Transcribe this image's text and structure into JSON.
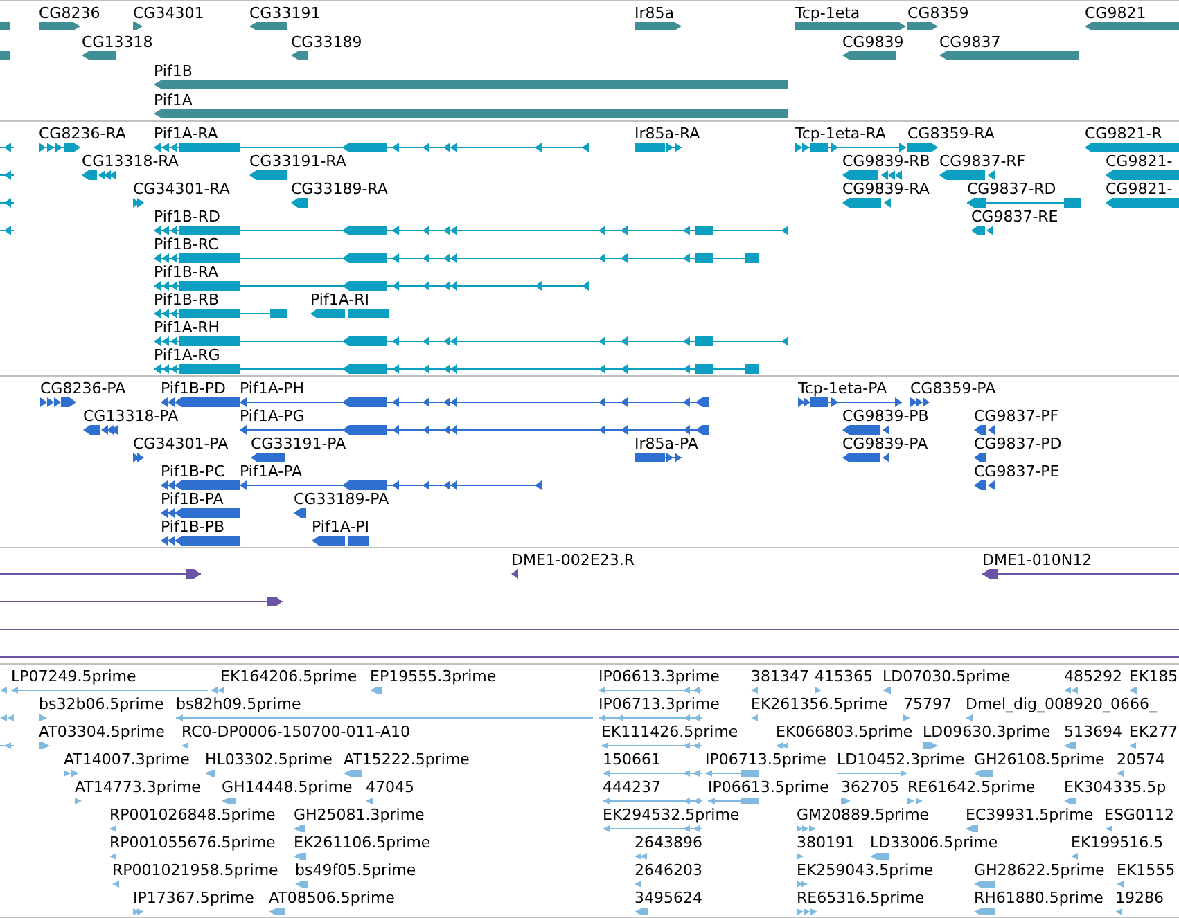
{
  "tracks": [
    {
      "kind": "gene",
      "features": [
        {
          "label": "CG8236"
        },
        {
          "label": "CG34301"
        },
        {
          "label": "CG33191"
        },
        {
          "label": "Ir85a"
        },
        {
          "label": "Tcp-1eta"
        },
        {
          "label": "CG8359"
        },
        {
          "label": "CG9821"
        },
        {
          "label": "CG13318"
        },
        {
          "label": "CG33189"
        },
        {
          "label": "CG9839"
        },
        {
          "label": "CG9837"
        },
        {
          "label": "Pif1B"
        },
        {
          "label": "Pif1A"
        }
      ]
    },
    {
      "kind": "mrna",
      "features": [
        {
          "label": "CG8236-RA"
        },
        {
          "label": "Pif1A-RA"
        },
        {
          "label": "Ir85a-RA"
        },
        {
          "label": "Tcp-1eta-RA"
        },
        {
          "label": "CG8359-RA"
        },
        {
          "label": "CG9821-R"
        },
        {
          "label": "CG13318-RA"
        },
        {
          "label": "CG33191-RA"
        },
        {
          "label": "CG9839-RB"
        },
        {
          "label": "CG9837-RF"
        },
        {
          "label": "CG9821-"
        },
        {
          "label": "CG34301-RA"
        },
        {
          "label": "CG33189-RA"
        },
        {
          "label": "CG9839-RA"
        },
        {
          "label": "CG9837-RD"
        },
        {
          "label": "CG9821-"
        },
        {
          "label": "Pif1B-RD"
        },
        {
          "label": "CG9837-RE"
        },
        {
          "label": "Pif1B-RC"
        },
        {
          "label": "Pif1B-RA"
        },
        {
          "label": "Pif1B-RB"
        },
        {
          "label": "Pif1A-RI"
        },
        {
          "label": "Pif1A-RH"
        },
        {
          "label": "Pif1A-RG"
        }
      ]
    },
    {
      "kind": "polypeptide",
      "features": [
        {
          "label": "CG8236-PA"
        },
        {
          "label": "Pif1B-PD"
        },
        {
          "label": "Pif1A-PH"
        },
        {
          "label": "Tcp-1eta-PA"
        },
        {
          "label": "CG8359-PA"
        },
        {
          "label": "CG13318-PA"
        },
        {
          "label": "Pif1A-PG"
        },
        {
          "label": "CG9839-PB"
        },
        {
          "label": "CG9837-PF"
        },
        {
          "label": "CG34301-PA"
        },
        {
          "label": "CG33191-PA"
        },
        {
          "label": "Ir85a-PA"
        },
        {
          "label": "CG9839-PA"
        },
        {
          "label": "CG9837-PD"
        },
        {
          "label": "Pif1B-PC"
        },
        {
          "label": "Pif1A-PA"
        },
        {
          "label": "CG9837-PE"
        },
        {
          "label": "Pif1B-PA"
        },
        {
          "label": "CG33189-PA"
        },
        {
          "label": "Pif1B-PB"
        },
        {
          "label": "Pif1A-PI"
        }
      ]
    },
    {
      "kind": "clone",
      "features": [
        {
          "label": "DME1-002E23.R"
        },
        {
          "label": "DME1-010N12"
        }
      ]
    },
    {
      "kind": "est",
      "features": [
        {
          "label": "LP07249.5prime"
        },
        {
          "label": "EK164206.5prime"
        },
        {
          "label": "EP19555.3prime"
        },
        {
          "label": "IP06613.3prime"
        },
        {
          "label": "381347"
        },
        {
          "label": "415365"
        },
        {
          "label": "LD07030.5prime"
        },
        {
          "label": "485292"
        },
        {
          "label": "EK185"
        },
        {
          "label": "bs32b06.5prime"
        },
        {
          "label": "bs82h09.5prime"
        },
        {
          "label": "IP06713.3prime"
        },
        {
          "label": "EK261356.5prime"
        },
        {
          "label": "75797"
        },
        {
          "label": "Dmel_dig_008920_0666_"
        },
        {
          "label": "AT03304.5prime"
        },
        {
          "label": "RC0-DP0006-150700-011-A10"
        },
        {
          "label": "EK111426.5prime"
        },
        {
          "label": "EK066803.5prime"
        },
        {
          "label": "LD09630.3prime"
        },
        {
          "label": "513694"
        },
        {
          "label": "EK277"
        },
        {
          "label": "AT14007.3prime"
        },
        {
          "label": "HL03302.5prime"
        },
        {
          "label": "AT15222.5prime"
        },
        {
          "label": "150661"
        },
        {
          "label": "IP06713.5prime"
        },
        {
          "label": "LD10452.3prime"
        },
        {
          "label": "GH26108.5prime"
        },
        {
          "label": "20574"
        },
        {
          "label": "AT14773.3prime"
        },
        {
          "label": "GH14448.5prime"
        },
        {
          "label": "47045"
        },
        {
          "label": "444237"
        },
        {
          "label": "IP06613.5prime"
        },
        {
          "label": "362705"
        },
        {
          "label": "RE61642.5prime"
        },
        {
          "label": "EK304335.5p"
        },
        {
          "label": "RP001026848.5prime"
        },
        {
          "label": "GH25081.3prime"
        },
        {
          "label": "EK294532.5prime"
        },
        {
          "label": "GM20889.5prime"
        },
        {
          "label": "EC39931.5prime"
        },
        {
          "label": "ESG0112"
        },
        {
          "label": "RP001055676.5prime"
        },
        {
          "label": "EK261106.5prime"
        },
        {
          "label": "2643896"
        },
        {
          "label": "380191"
        },
        {
          "label": "LD33006.5prime"
        },
        {
          "label": "EK199516.5"
        },
        {
          "label": "RP001021958.5prime"
        },
        {
          "label": "bs49f05.5prime"
        },
        {
          "label": "2646203"
        },
        {
          "label": "EK259043.5prime"
        },
        {
          "label": "GH28622.5prime"
        },
        {
          "label": "EK1555"
        },
        {
          "label": "IP17367.5prime"
        },
        {
          "label": "AT08506.5prime"
        },
        {
          "label": "3495624"
        },
        {
          "label": "RE65316.5prime"
        },
        {
          "label": "RH61880.5prime"
        },
        {
          "label": "19286"
        }
      ]
    }
  ]
}
